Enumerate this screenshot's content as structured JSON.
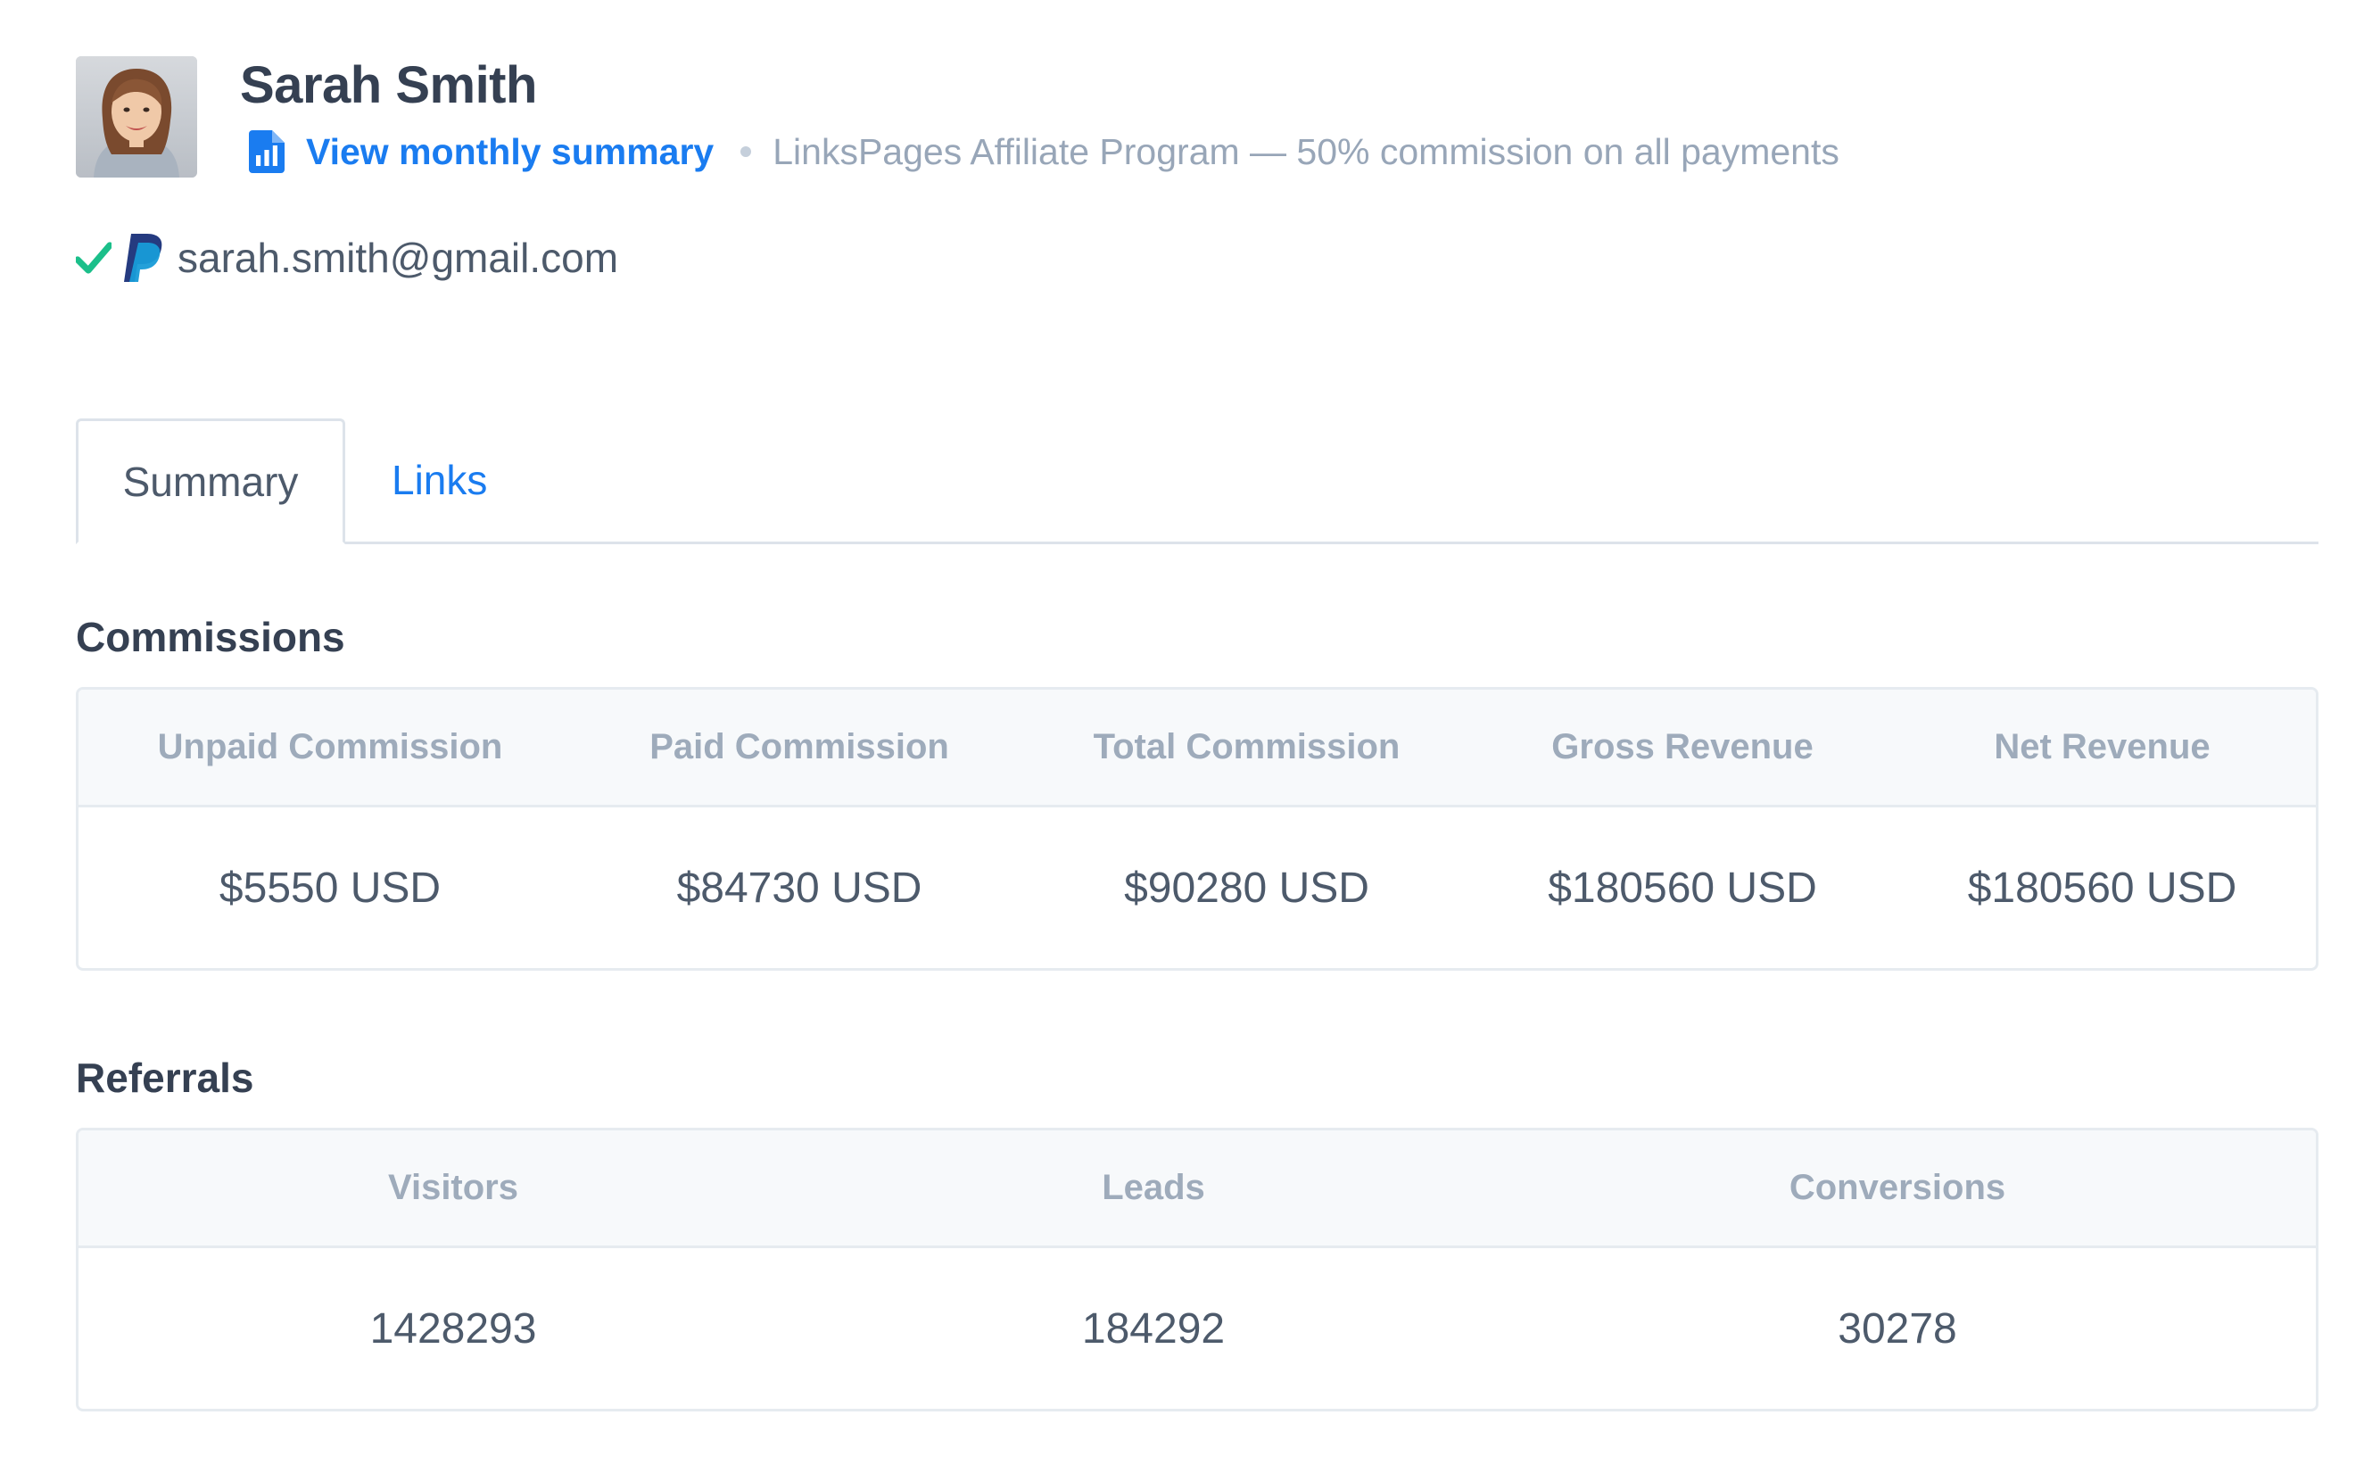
{
  "profile": {
    "name": "Sarah Smith",
    "summary_link": "View monthly summary",
    "program": "LinksPages Affiliate Program — 50% commission on all payments",
    "email": "sarah.smith@gmail.com"
  },
  "icons": {
    "summary": "bar-chart-document-icon",
    "verified": "check-icon",
    "payment": "paypal-icon"
  },
  "colors": {
    "link": "#1a7cf0",
    "verified": "#1bbf8a",
    "paypal_dark": "#253b80",
    "paypal_light": "#179bd7"
  },
  "tabs": [
    {
      "label": "Summary",
      "active": true
    },
    {
      "label": "Links",
      "active": false
    }
  ],
  "commissions": {
    "title": "Commissions",
    "headers": [
      "Unpaid Commission",
      "Paid Commission",
      "Total Commission",
      "Gross Revenue",
      "Net Revenue"
    ],
    "values": [
      "$5550 USD",
      "$84730 USD",
      "$90280 USD",
      "$180560 USD",
      "$180560 USD"
    ]
  },
  "referrals": {
    "title": "Referrals",
    "headers": [
      "Visitors",
      "Leads",
      "Conversions"
    ],
    "values": [
      "1428293",
      "184292",
      "30278"
    ]
  }
}
